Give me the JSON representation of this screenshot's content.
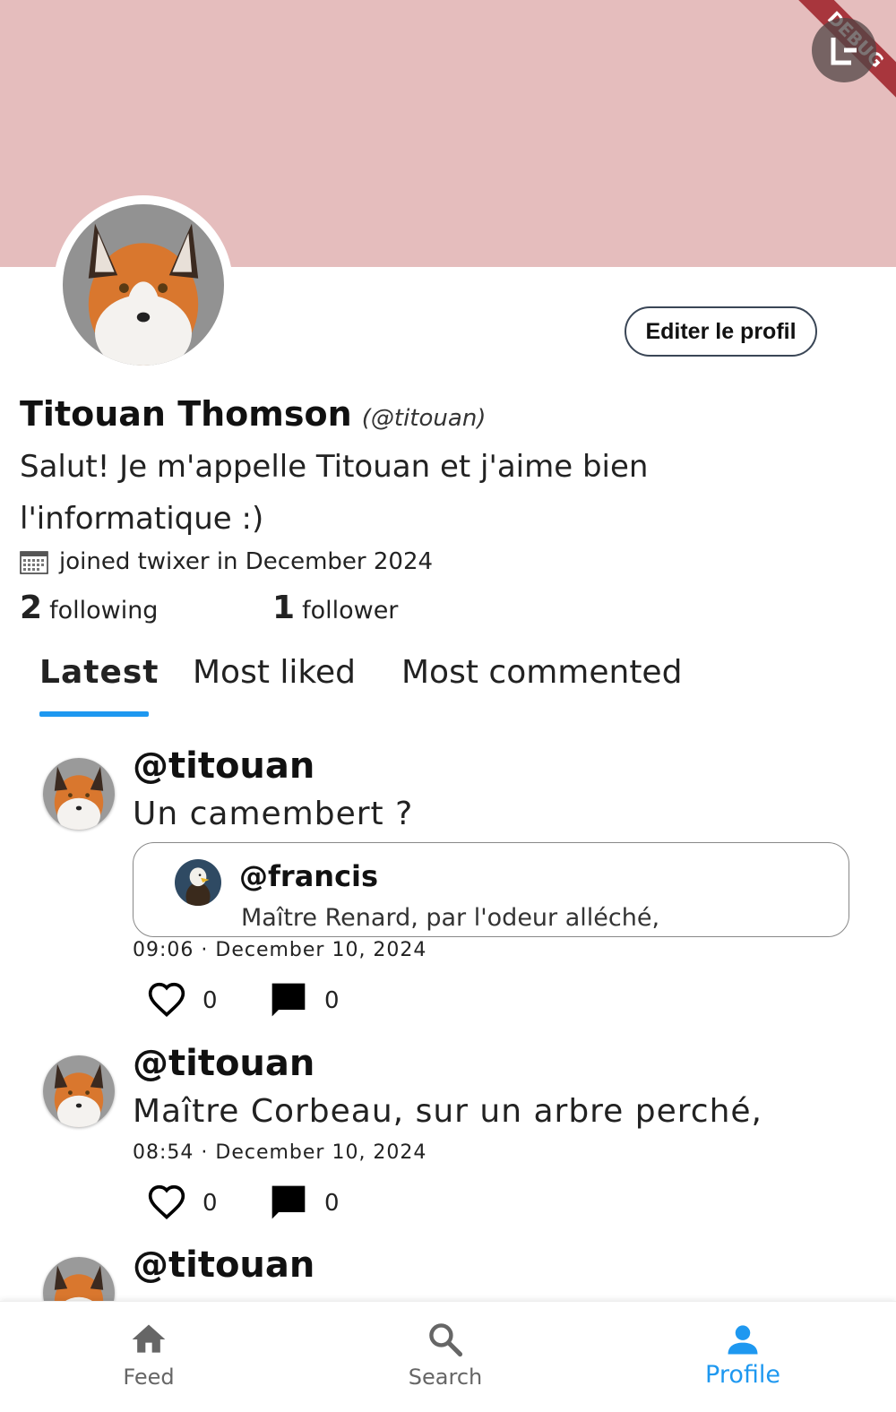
{
  "debug_banner": "DEBUG",
  "profile": {
    "name": "Titouan Thomson",
    "handle": "(@titouan)",
    "bio": "Salut! Je m'appelle Titouan et j'aime bien l'informatique :)",
    "joined": "joined twixer in December 2024",
    "edit_label": "Editer le profil",
    "following_count": "2",
    "following_label": "following",
    "followers_count": "1",
    "followers_label": "follower"
  },
  "tabs": [
    {
      "label": "Latest",
      "active": true
    },
    {
      "label": "Most liked",
      "active": false
    },
    {
      "label": "Most commented",
      "active": false
    }
  ],
  "posts": [
    {
      "user": "@titouan",
      "text": "Un camembert ?",
      "quote": {
        "user": "@francis",
        "text": "Maître Renard, par l'odeur alléché,"
      },
      "time": "09:06 · December 10, 2024",
      "likes": "0",
      "comments": "0"
    },
    {
      "user": "@titouan",
      "text": " Maître Corbeau, sur un arbre perché,",
      "time": "08:54 · December 10, 2024",
      "likes": "0",
      "comments": "0"
    },
    {
      "user": "@titouan"
    }
  ],
  "nav": {
    "feed": "Feed",
    "search": "Search",
    "profile": "Profile"
  },
  "colors": {
    "banner": "#e5bdbd",
    "accent": "#1e98f0"
  },
  "icons": [
    "logout-icon",
    "calendar-icon",
    "heart-icon",
    "comment-icon",
    "home-icon",
    "search-icon",
    "person-icon"
  ]
}
